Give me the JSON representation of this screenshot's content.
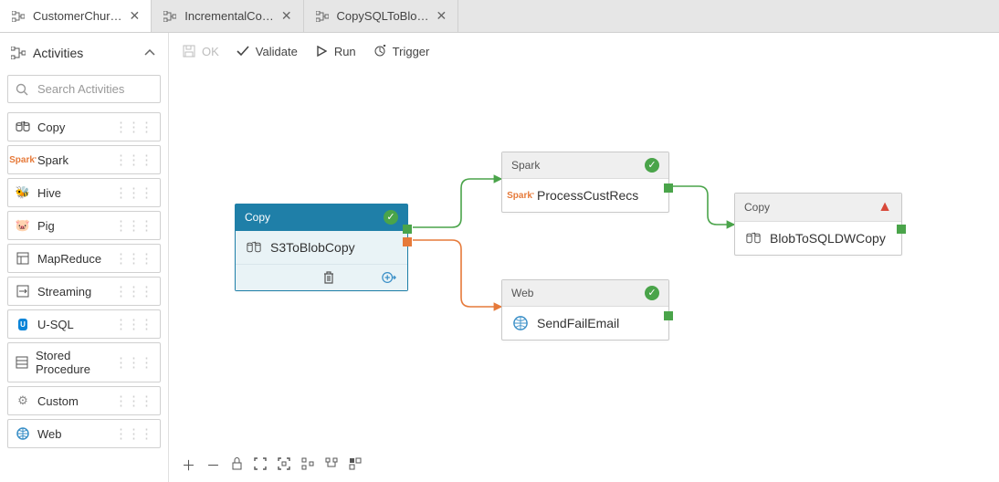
{
  "tabs": [
    {
      "label": "CustomerChur…",
      "active": true
    },
    {
      "label": "IncrementalCo…",
      "active": false
    },
    {
      "label": "CopySQLToBlo…",
      "active": false
    }
  ],
  "sidebar": {
    "title": "Activities",
    "search_placeholder": "Search Activities",
    "items": [
      {
        "label": "Copy",
        "icon": "copy"
      },
      {
        "label": "Spark",
        "icon": "spark"
      },
      {
        "label": "Hive",
        "icon": "hive"
      },
      {
        "label": "Pig",
        "icon": "pig"
      },
      {
        "label": "MapReduce",
        "icon": "mapreduce"
      },
      {
        "label": "Streaming",
        "icon": "streaming"
      },
      {
        "label": "U-SQL",
        "icon": "usql"
      },
      {
        "label": "Stored Procedure",
        "icon": "sproc"
      },
      {
        "label": "Custom",
        "icon": "gear"
      },
      {
        "label": "Web",
        "icon": "web"
      }
    ]
  },
  "toolbar": {
    "ok": "OK",
    "validate": "Validate",
    "run": "Run",
    "trigger": "Trigger"
  },
  "nodes": {
    "copy1": {
      "type": "Copy",
      "title": "S3ToBlobCopy",
      "status": "ok",
      "selected": true
    },
    "spark1": {
      "type": "Spark",
      "title": "ProcessCustRecs",
      "status": "ok"
    },
    "web1": {
      "type": "Web",
      "title": "SendFailEmail",
      "status": "ok"
    },
    "copy2": {
      "type": "Copy",
      "title": "BlobToSQLDWCopy",
      "status": "warn"
    }
  }
}
